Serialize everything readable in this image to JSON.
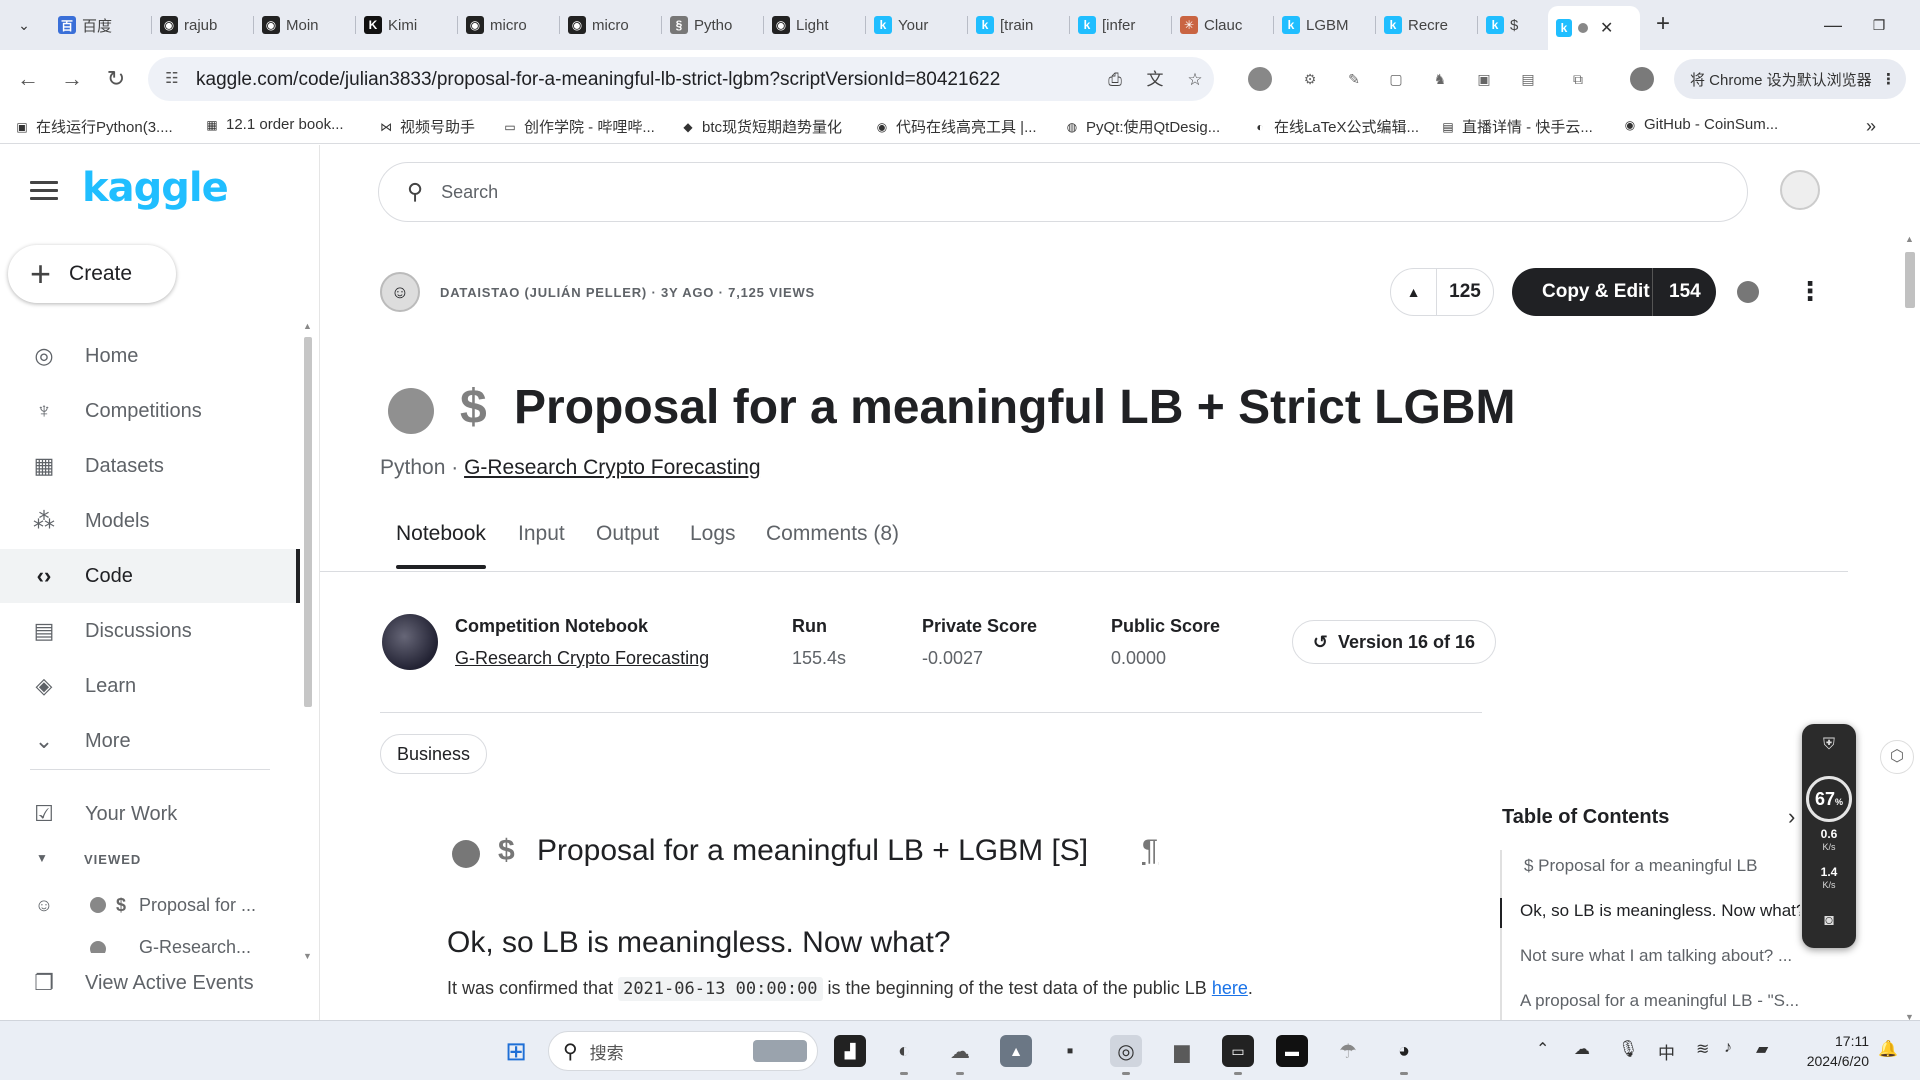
{
  "browser": {
    "tabs": [
      {
        "label": "百度",
        "fav": "百",
        "fav_color": "#3a6fd8"
      },
      {
        "label": "rajub",
        "fav": "◉",
        "fav_color": "#222222"
      },
      {
        "label": "Moin",
        "fav": "◉",
        "fav_color": "#222222"
      },
      {
        "label": "Kimi",
        "fav": "K",
        "fav_color": "#111111"
      },
      {
        "label": "micro",
        "fav": "◉",
        "fav_color": "#222222"
      },
      {
        "label": "micro",
        "fav": "◉",
        "fav_color": "#222222"
      },
      {
        "label": "Pytho",
        "fav": "§",
        "fav_color": "#777777"
      },
      {
        "label": "Light",
        "fav": "◉",
        "fav_color": "#222222"
      },
      {
        "label": "Your",
        "fav": "k",
        "fav_color": "#20beff"
      },
      {
        "label": "[train",
        "fav": "k",
        "fav_color": "#20beff"
      },
      {
        "label": "[infer",
        "fav": "k",
        "fav_color": "#20beff"
      },
      {
        "label": "Clauc",
        "fav": "✳",
        "fav_color": "#c96442"
      },
      {
        "label": "LGBM",
        "fav": "k",
        "fav_color": "#20beff"
      },
      {
        "label": "Recre",
        "fav": "k",
        "fav_color": "#20beff"
      },
      {
        "label": "$",
        "fav": "k",
        "fav_color": "#20beff"
      }
    ],
    "url_host": "kaggle.com",
    "url_path": "/code/julian3833/proposal-for-a-meaningful-lb-strict-lgbm?scriptVersionId=80421622",
    "default_browser_text": "将 Chrome 设为默认浏览器",
    "bookmarks": [
      "在线运行Python(3....",
      "12.1 order book...",
      "视频号助手",
      "创作学院 - 哔哩哔...",
      "btc现货短期趋势量化",
      "代码在线高亮工具 |...",
      "PyQt:使用QtDesig...",
      "在线LaTeX公式编辑...",
      "直播详情 - 快手云...",
      "GitHub - CoinSum..."
    ]
  },
  "sidebar": {
    "logo": "kaggle",
    "create_label": "Create",
    "items": [
      {
        "label": "Home",
        "icon": "compass-icon"
      },
      {
        "label": "Competitions",
        "icon": "trophy-icon"
      },
      {
        "label": "Datasets",
        "icon": "table-icon"
      },
      {
        "label": "Models",
        "icon": "models-icon"
      },
      {
        "label": "Code",
        "icon": "code-icon"
      },
      {
        "label": "Discussions",
        "icon": "chat-icon"
      },
      {
        "label": "Learn",
        "icon": "school-icon"
      },
      {
        "label": "More",
        "icon": "chevron-down-icon"
      }
    ],
    "your_work": "Your Work",
    "viewed_label": "VIEWED",
    "viewed_items": [
      "Proposal for ...",
      "G-Research..."
    ],
    "view_active_events": "View Active Events"
  },
  "search": {
    "placeholder": "Search"
  },
  "notebook": {
    "meta": "DATAISTAO (JULIÁN PELLER) · 3Y AGO · 7,125 VIEWS",
    "upvotes": "125",
    "copy_edit_label": "Copy & Edit",
    "copy_edit_count": "154",
    "title": "Proposal for a meaningful LB + Strict LGBM",
    "title_dollar": "$",
    "language": "Python",
    "subtitle_sep": " · ",
    "competition": "G-Research Crypto Forecasting",
    "tabs": [
      "Notebook",
      "Input",
      "Output",
      "Logs",
      "Comments (8)"
    ],
    "info": {
      "type_label": "Competition Notebook",
      "competition_link": "G-Research Crypto Forecasting",
      "run_label": "Run",
      "run_value": "155.4s",
      "private_label": "Private Score",
      "private_value": "-0.0027",
      "public_label": "Public Score",
      "public_value": "0.0000",
      "version": "Version 16 of 16"
    },
    "tag": "Business",
    "cell": {
      "dollar": "$",
      "h1": "Proposal for a meaningful LB + LGBM [S]",
      "pilcrow": "¶",
      "h2": "Ok, so LB is meaningless. Now what?",
      "p_before": "It was confirmed that ",
      "p_code": "2021-06-13 00:00:00",
      "p_after": " is the beginning of the test data of the public LB ",
      "p_link": "here",
      "p_end": "."
    }
  },
  "toc": {
    "title": "Table of Contents",
    "items": [
      "$ Proposal for a meaningful LB",
      "Ok, so LB is meaningless. Now what?",
      "Not sure what I am talking about? ...",
      "A proposal for a meaningful LB - \"S..."
    ]
  },
  "net_widget": {
    "percent": "67",
    "percent_unit": "%",
    "up_value": "0.6",
    "up_unit": "K/s",
    "down_value": "1.4",
    "down_unit": "K/s"
  },
  "taskbar": {
    "search_placeholder": "搜索",
    "ime": "中",
    "time": "17:11",
    "date": "2024/6/20"
  }
}
